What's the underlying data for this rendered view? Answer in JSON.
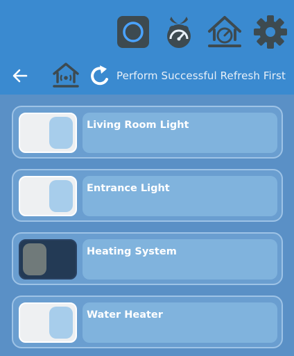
{
  "header": {
    "icons": [
      {
        "name": "circle-button-icon"
      },
      {
        "name": "raspberry-pi-icon"
      },
      {
        "name": "smart-home-gauge-icon"
      },
      {
        "name": "gear-icon"
      }
    ],
    "back_icon": "back-arrow-icon",
    "home_icon": "home-wifi-icon",
    "refresh_icon": "refresh-icon",
    "status": "Perform Successful Refresh First"
  },
  "devices": [
    {
      "label": "Living Room Light",
      "state": "on"
    },
    {
      "label": "Entrance Light",
      "state": "on"
    },
    {
      "label": "Heating System",
      "state": "off"
    },
    {
      "label": "Water Heater",
      "state": "on"
    }
  ],
  "colors": {
    "topbar": "#3a8ad0",
    "background": "#5a90c6",
    "card_border": "#9ec3e6",
    "label_box": "#80b3dd",
    "toggle_on": "#eef0f2",
    "toggle_off": "#233a55",
    "icon_dark": "#3d4a50"
  }
}
